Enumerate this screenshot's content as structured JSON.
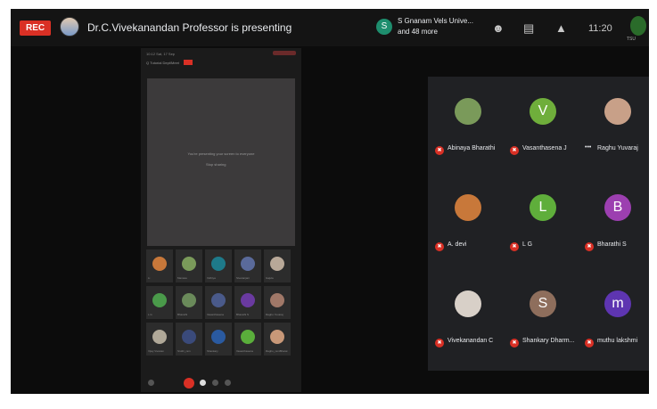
{
  "topbar": {
    "rec_label": "REC",
    "presenting_text": "Dr.C.Vivekanandan Professor is presenting",
    "others_initial": "S",
    "others_line1": "S Gnanam Vels Unive...",
    "others_line2": "and 48 more",
    "icons": [
      "people-icon",
      "chat-icon",
      "activities-icon"
    ],
    "clock": "11:20",
    "badge_text": "TSU"
  },
  "shared_screen": {
    "status_left": "10:12  Sat, 17 Sep",
    "header_text": "Q  Tutorial Dept/Meet",
    "stage_text": "You're presenting your screen to everyone",
    "stage_button": "Stop sharing",
    "tile_names": [
      "Li",
      "Manasa",
      "Vidhiya",
      "Sivaranjani",
      "Gajula",
      "L G",
      "Bharathi",
      "Vasanthasena",
      "Bharathi S",
      "Raghu Yuvaraj",
      "Vijay Vivekan",
      "Sruthi_ram",
      "Shankary",
      "Vasanthasena",
      "Raghu_ramBharat"
    ]
  },
  "participants": [
    {
      "name": "Abinaya Bharathi",
      "initial": "",
      "color": "#7a9a5a",
      "photo": true,
      "menu": false
    },
    {
      "name": "Vasanthasena J",
      "initial": "V",
      "color": "#6fae3b",
      "photo": false,
      "menu": false
    },
    {
      "name": "Raghu Yuvaraj",
      "initial": "",
      "color": "#c8a088",
      "photo": true,
      "menu": true
    },
    {
      "name": "A. devi",
      "initial": "",
      "color": "#c8783a",
      "photo": true,
      "menu": false
    },
    {
      "name": "L G",
      "initial": "L",
      "color": "#5fae3b",
      "photo": false,
      "menu": false
    },
    {
      "name": "Bharathi S",
      "initial": "B",
      "color": "#9c3fb0",
      "photo": false,
      "menu": false
    },
    {
      "name": "Vivekanandan C",
      "initial": "",
      "color": "#d8d0c8",
      "photo": true,
      "menu": false
    },
    {
      "name": "Shankary Dharm...",
      "initial": "S",
      "color": "#8e6e5c",
      "photo": false,
      "menu": false
    },
    {
      "name": "muthu lakshmi",
      "initial": "m",
      "color": "#5e35b1",
      "photo": false,
      "menu": false
    }
  ],
  "colors": {
    "rec_red": "#d93025",
    "background": "#0c0c0c",
    "tile_bg": "#202124"
  }
}
